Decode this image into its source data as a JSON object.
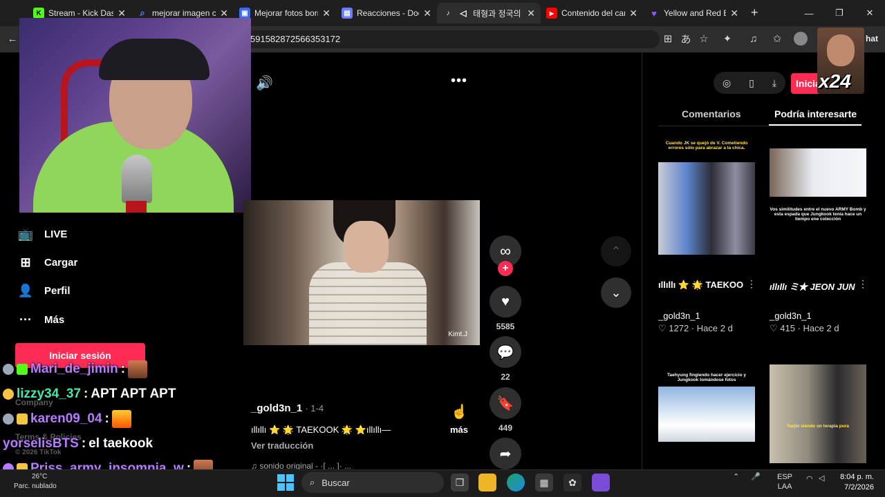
{
  "tabs": [
    {
      "title": "Stream - Kick Dashb",
      "favicon": "kick-icon",
      "color": "#53fc18"
    },
    {
      "title": "mejorar imagen con",
      "favicon": "search-icon",
      "color": "#4a8cff"
    },
    {
      "title": "Mejorar fotos borro",
      "favicon": "photo-icon",
      "color": "#3a6cff"
    },
    {
      "title": "Reacciones - Doc",
      "favicon": "doc-icon",
      "color": "#6b7cff"
    },
    {
      "title": "태형과 정국의",
      "favicon": "tiktok-icon",
      "color": "#ffffff"
    },
    {
      "title": "Contenido del cana",
      "favicon": "youtube-icon",
      "color": "#ff0000"
    },
    {
      "title": "Yellow and Red Bri",
      "favicon": "heart-icon",
      "color": "#8a5cff"
    }
  ],
  "address": {
    "url": "591582872566353172",
    "right_label": "hat"
  },
  "nav": {
    "live": "LIVE",
    "upload": "Cargar",
    "profile": "Perfil",
    "more": "Más",
    "login": "Iniciar sesión",
    "company": "Company",
    "terms": "Terms & Policies",
    "copyright": "© 2026 TikTok"
  },
  "chat": [
    {
      "user": "Mari_de_jimin",
      "message": "",
      "color": "#b77bff"
    },
    {
      "user": "lizzy34_37",
      "message": "APT APT APT",
      "color": "#43e8b0"
    },
    {
      "user": "karen09_04",
      "message": "",
      "color": "#b77bff"
    },
    {
      "user": "yorselisBTS",
      "message": "el taekook",
      "color": "#b77bff"
    },
    {
      "user": "Priss_army_insomnia_w",
      "message": "",
      "color": "#b77bff"
    }
  ],
  "video": {
    "watermark": "Kimt.J",
    "author": "_gold3n_1",
    "part": "· 1-4",
    "caption": "ıllıllı ⭐ 🌟 TAEKOOK 🌟 ⭐ıllıllı—",
    "more": "más",
    "translate": "Ver traducción",
    "sound": "♫ sonido original - ·[ ... ]· ..."
  },
  "actions": {
    "likes": "5585",
    "comments": "22",
    "saves": "449"
  },
  "right_panel": {
    "login": "Iniciar",
    "overlay_badge": "x24",
    "tab_comments": "Comentarios",
    "tab_suggested": "Podría interesarte",
    "items": [
      {
        "thumb_text": "Cuando JK se quejó de V. Cometiendo errores sólo para abrazar a la chica.",
        "title": "ıllıllı ⭐ 🌟 TAEKOOK 🌟 ...",
        "author": "_gold3n_1",
        "likes": "1272",
        "age": "Hace 2 d"
      },
      {
        "thumb_text": "Vos similitudes entre el nuevo ARMY Bomb y esta espada que Jungkook tenía hace un tiempo ene colección",
        "title": "ıllıllı ミ★ JEON JUNGKOOK ★彡...",
        "author": "_gold3n_1",
        "likes": "415",
        "age": "Hace 2 d"
      },
      {
        "thumb_text": "Taehyung fingiendo hacer ejercicio y Jungkook tomándose fotos",
        "title": "",
        "author": "",
        "likes": "",
        "age": ""
      },
      {
        "thumb_text": "Taejin siendo un terapia pura",
        "title": "",
        "author": "",
        "likes": "",
        "age": ""
      }
    ]
  },
  "taskbar": {
    "temp": "26°C",
    "weather": "Parc. nublado",
    "search": "Buscar",
    "lang1": "ESP",
    "lang2": "LAA",
    "time": "8:04 p. m.",
    "date": "7/2/2026"
  },
  "colors": {
    "accent": "#fe2c55",
    "bg": "#000000",
    "chrome": "#2d2d2d"
  }
}
